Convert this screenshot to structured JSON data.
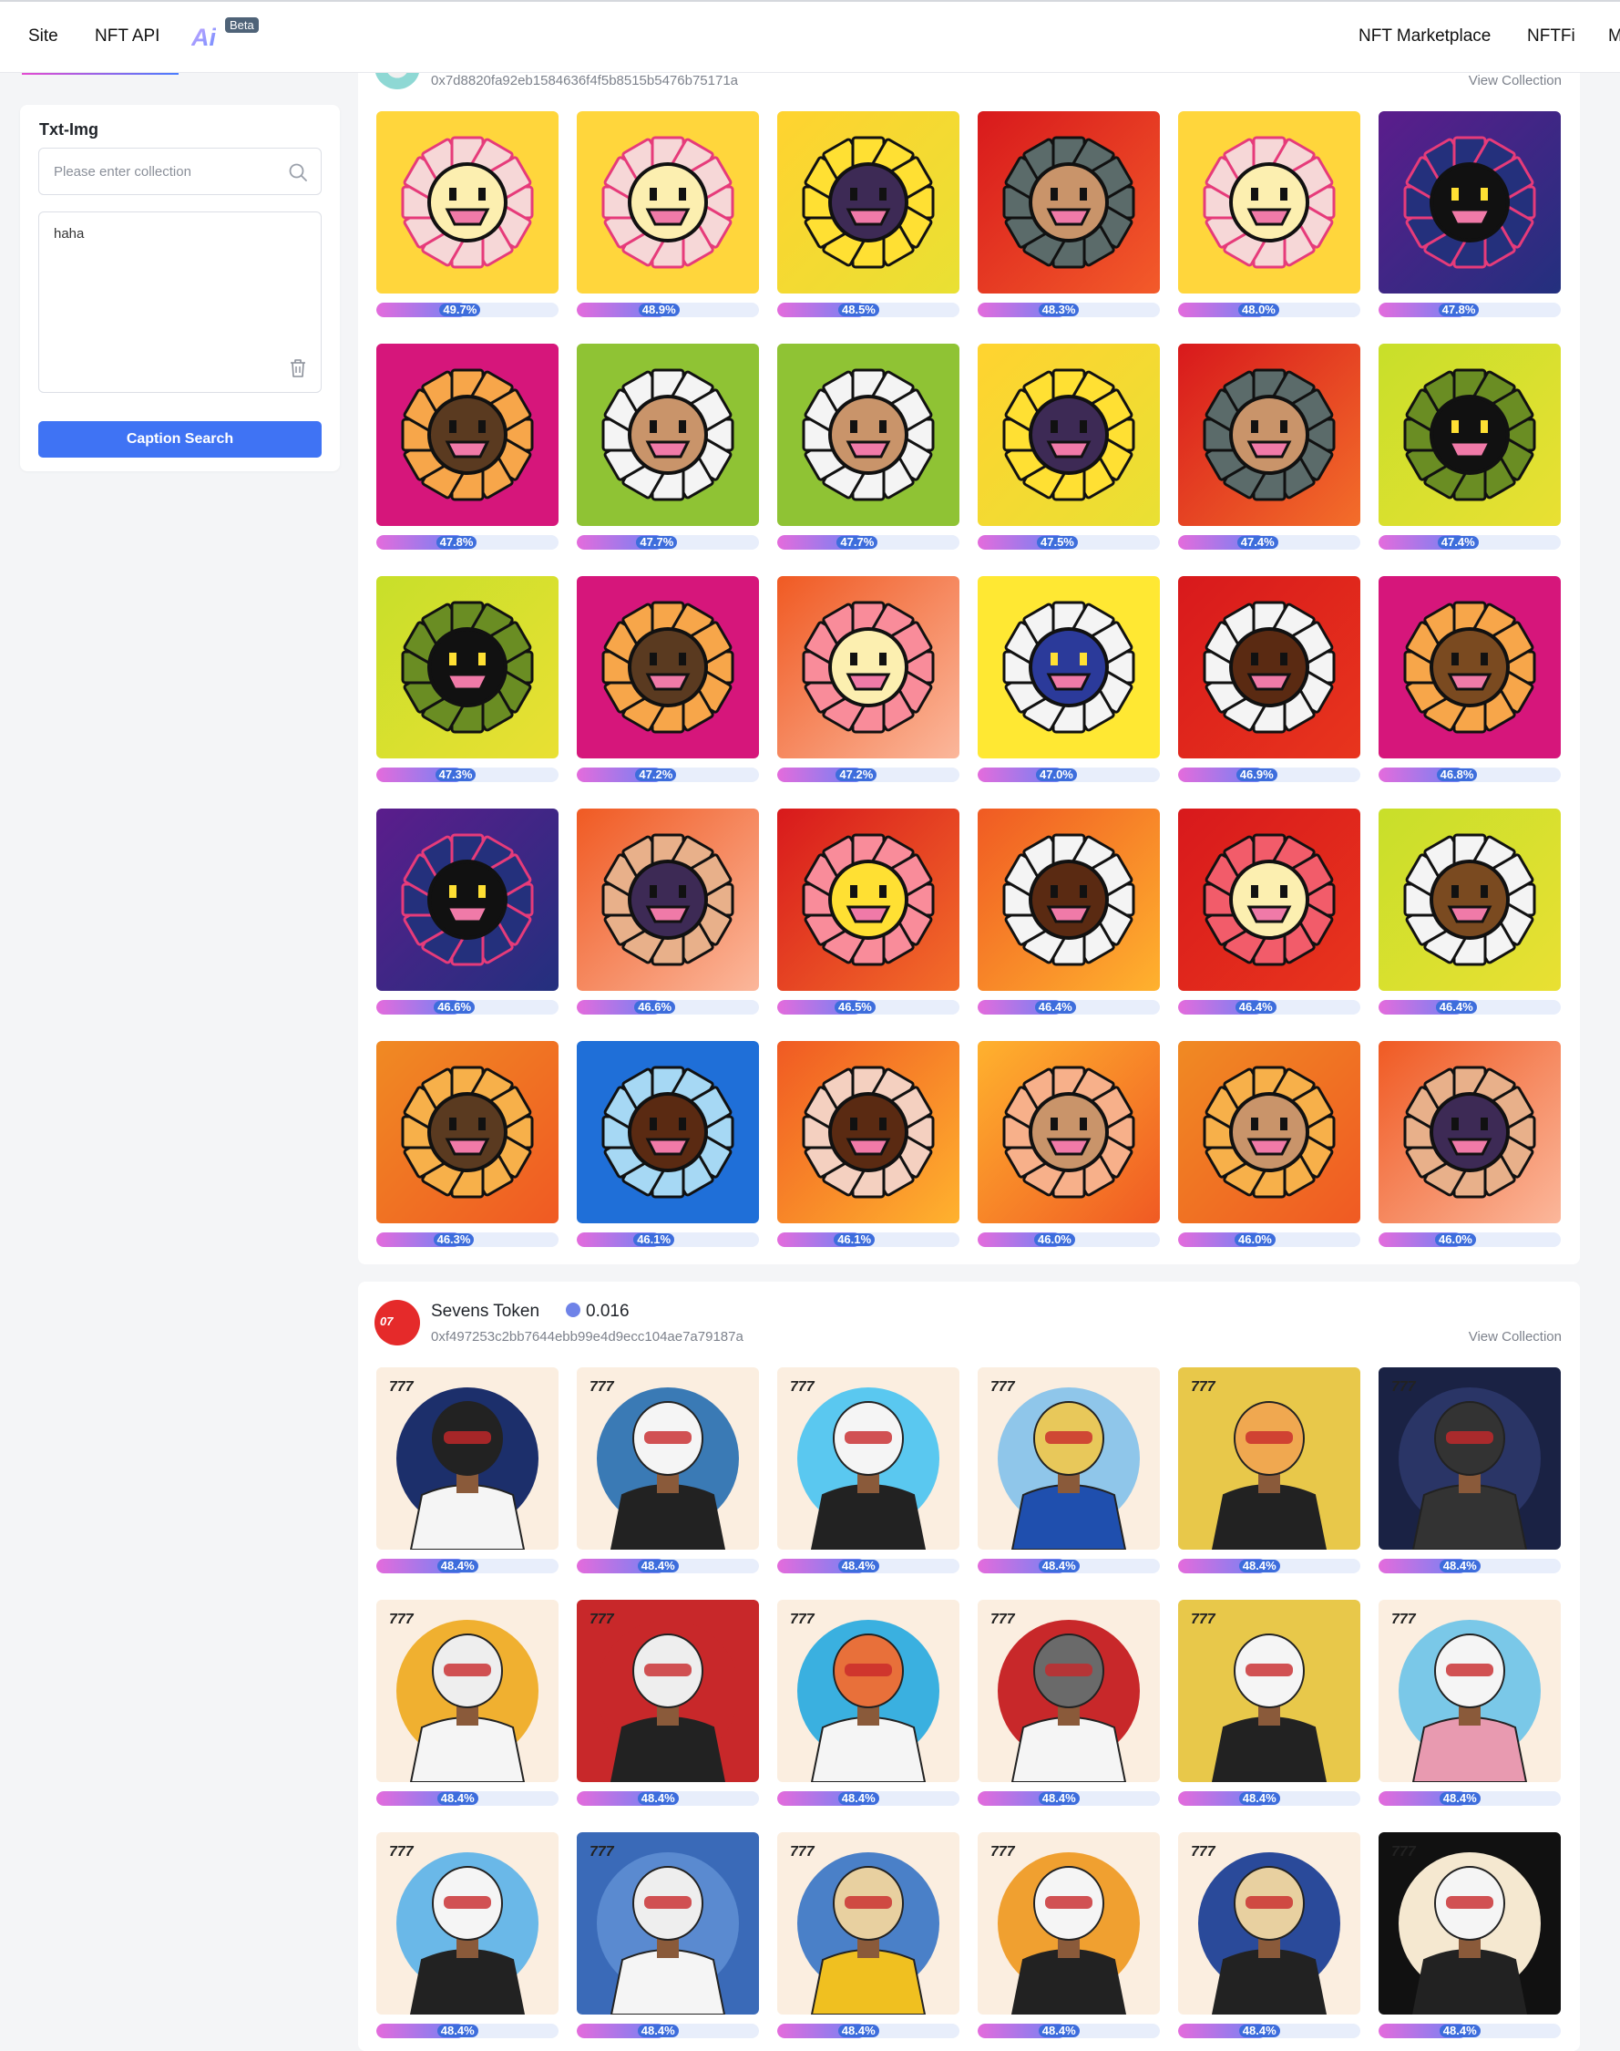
{
  "nav": {
    "items": [
      "Site",
      "NFT API"
    ],
    "ai_logo": "Ai",
    "beta_badge": "Beta",
    "right_items": [
      "NFT Marketplace",
      "NFTFi",
      "M"
    ]
  },
  "sidebar": {
    "title": "Txt-Img",
    "search_placeholder": "Please enter collection",
    "query_text": "haha",
    "button_label": "Caption Search"
  },
  "collections": [
    {
      "name": "",
      "price": "",
      "address": "0x7d8820fa92eb1584636f4f5b8515b5476b75171a",
      "view_label": "View Collection",
      "accent": "#f7c9d9",
      "items": [
        {
          "score": "49.7%",
          "bg": [
            "#ffd63c",
            "#ffd63c"
          ],
          "petal": "#f6d7d7",
          "outline": "#e63b7a",
          "face": "#fcefb0",
          "eyes": "#111"
        },
        {
          "score": "48.9%",
          "bg": [
            "#ffd63c",
            "#ffd63c"
          ],
          "petal": "#f6d7d7",
          "outline": "#e63b7a",
          "face": "#fcefb0",
          "eyes": "#111"
        },
        {
          "score": "48.5%",
          "bg": [
            "#ffd330",
            "#e9e033"
          ],
          "petal": "#ffe033",
          "outline": "#111",
          "face": "#3d2a55",
          "eyes": "#111"
        },
        {
          "score": "48.3%",
          "bg": [
            "#d8191c",
            "#f35b2a"
          ],
          "petal": "#5b6b6a",
          "outline": "#111",
          "face": "#c9946a",
          "eyes": "#111"
        },
        {
          "score": "48.0%",
          "bg": [
            "#ffd63c",
            "#ffd63c"
          ],
          "petal": "#f6d7d7",
          "outline": "#e63b7a",
          "face": "#fcefb0",
          "eyes": "#111"
        },
        {
          "score": "47.8%",
          "bg": [
            "#5b1d8c",
            "#23307e"
          ],
          "petal": "#24307c",
          "outline": "#e63b7a",
          "face": "#111",
          "eyes": "#ffe033"
        },
        {
          "score": "47.8%",
          "bg": [
            "#d6167b",
            "#d6167b"
          ],
          "petal": "#f7a64a",
          "outline": "#111",
          "face": "#5a3a20",
          "eyes": "#111"
        },
        {
          "score": "47.7%",
          "bg": [
            "#8fc334",
            "#8fc334"
          ],
          "petal": "#f4f4f4",
          "outline": "#111",
          "face": "#c9946a",
          "eyes": "#111"
        },
        {
          "score": "47.7%",
          "bg": [
            "#8fc334",
            "#8fc334"
          ],
          "petal": "#f4f4f4",
          "outline": "#111",
          "face": "#c9946a",
          "eyes": "#111"
        },
        {
          "score": "47.5%",
          "bg": [
            "#ffd330",
            "#e9e033"
          ],
          "petal": "#ffe033",
          "outline": "#111",
          "face": "#3d2a55",
          "eyes": "#111"
        },
        {
          "score": "47.4%",
          "bg": [
            "#d8191c",
            "#f36e2a"
          ],
          "petal": "#5b6b6a",
          "outline": "#111",
          "face": "#c9946a",
          "eyes": "#111"
        },
        {
          "score": "47.4%",
          "bg": [
            "#c8df2a",
            "#e9e033"
          ],
          "petal": "#6a8d23",
          "outline": "#111",
          "face": "#111",
          "eyes": "#ffe033"
        },
        {
          "score": "47.3%",
          "bg": [
            "#c8df2a",
            "#e9e033"
          ],
          "petal": "#6a8d23",
          "outline": "#111",
          "face": "#111",
          "eyes": "#ffe033"
        },
        {
          "score": "47.2%",
          "bg": [
            "#d6167b",
            "#d6167b"
          ],
          "petal": "#f7a64a",
          "outline": "#111",
          "face": "#5a3a20",
          "eyes": "#111"
        },
        {
          "score": "47.2%",
          "bg": [
            "#f05a23",
            "#fbb79b"
          ],
          "petal": "#f98c9a",
          "outline": "#111",
          "face": "#fcefb0",
          "eyes": "#111"
        },
        {
          "score": "47.0%",
          "bg": [
            "#ffe833",
            "#ffe833"
          ],
          "petal": "#f4f4f4",
          "outline": "#111",
          "face": "#2b3a9a",
          "eyes": "#ffe033"
        },
        {
          "score": "46.9%",
          "bg": [
            "#d8191c",
            "#e8351d"
          ],
          "petal": "#f4f4f4",
          "outline": "#111",
          "face": "#5a2a12",
          "eyes": "#111"
        },
        {
          "score": "46.8%",
          "bg": [
            "#d6167b",
            "#d6167b"
          ],
          "petal": "#f7a64a",
          "outline": "#111",
          "face": "#7a4a20",
          "eyes": "#111"
        },
        {
          "score": "46.6%",
          "bg": [
            "#5b1d8c",
            "#23307e"
          ],
          "petal": "#24307c",
          "outline": "#e63b7a",
          "face": "#111",
          "eyes": "#ffe033"
        },
        {
          "score": "46.6%",
          "bg": [
            "#f05a23",
            "#fbb79b"
          ],
          "petal": "#e8b08a",
          "outline": "#111",
          "face": "#3d2a55",
          "eyes": "#111"
        },
        {
          "score": "46.5%",
          "bg": [
            "#d8191c",
            "#f36e2a"
          ],
          "petal": "#f98c9a",
          "outline": "#111",
          "face": "#ffe033",
          "eyes": "#111"
        },
        {
          "score": "46.4%",
          "bg": [
            "#f05a23",
            "#ffb22e"
          ],
          "petal": "#f4f4f4",
          "outline": "#111",
          "face": "#5a2a12",
          "eyes": "#111"
        },
        {
          "score": "46.4%",
          "bg": [
            "#d8191c",
            "#e8351d"
          ],
          "petal": "#f25c6a",
          "outline": "#111",
          "face": "#fcefb0",
          "eyes": "#111"
        },
        {
          "score": "46.4%",
          "bg": [
            "#c8df2a",
            "#e9e033"
          ],
          "petal": "#f4f4f4",
          "outline": "#111",
          "face": "#7a4a20",
          "eyes": "#111"
        },
        {
          "score": "46.3%",
          "bg": [
            "#f08a23",
            "#f05a23"
          ],
          "petal": "#f7b04a",
          "outline": "#111",
          "face": "#5a3a20",
          "eyes": "#111"
        },
        {
          "score": "46.1%",
          "bg": [
            "#1f6fd8",
            "#1f6fd8"
          ],
          "petal": "#a6d8f4",
          "outline": "#111",
          "face": "#5a2a12",
          "eyes": "#111"
        },
        {
          "score": "46.1%",
          "bg": [
            "#f05a23",
            "#ffb22e"
          ],
          "petal": "#f4d0c0",
          "outline": "#111",
          "face": "#5a2a12",
          "eyes": "#111"
        },
        {
          "score": "46.0%",
          "bg": [
            "#ffb22e",
            "#f05a23"
          ],
          "petal": "#f7b08a",
          "outline": "#111",
          "face": "#c9946a",
          "eyes": "#111"
        },
        {
          "score": "46.0%",
          "bg": [
            "#f08a23",
            "#f05a23"
          ],
          "petal": "#f7b04a",
          "outline": "#111",
          "face": "#c9946a",
          "eyes": "#111"
        },
        {
          "score": "46.0%",
          "bg": [
            "#f05a23",
            "#fbb79b"
          ],
          "petal": "#e8b08a",
          "outline": "#111",
          "face": "#3d2a55",
          "eyes": "#111"
        }
      ]
    },
    {
      "name": "Sevens Token",
      "price": "0.016",
      "address": "0xf497253c2bb7644ebb99e4d9ecc104ae7a79187a",
      "view_label": "View Collection",
      "accent": "#e52a2a",
      "items": [
        {
          "score": "48.4%",
          "bg": "#fbeee0",
          "circle": "#1c2f6b",
          "head": "#222",
          "body": "#f5f5f5"
        },
        {
          "score": "48.4%",
          "bg": "#fbeee0",
          "circle": "#3a7ab5",
          "head": "#f5f5f5",
          "body": "#222"
        },
        {
          "score": "48.4%",
          "bg": "#fbeee0",
          "circle": "#5ac8f0",
          "head": "#f5f5f5",
          "body": "#222"
        },
        {
          "score": "48.4%",
          "bg": "#fbeee0",
          "circle": "#8fc6ea",
          "head": "#e8c85a",
          "body": "#1f4fae"
        },
        {
          "score": "48.4%",
          "bg": "#e8c84a",
          "circle": "#e8c84a",
          "head": "#f0a850",
          "body": "#222"
        },
        {
          "score": "48.4%",
          "bg": "#1a2244",
          "circle": "#2a3566",
          "head": "#333",
          "body": "#333"
        },
        {
          "score": "48.4%",
          "bg": "#fbeee0",
          "circle": "#f0b030",
          "head": "#eee",
          "body": "#f5f5f5"
        },
        {
          "score": "48.4%",
          "bg": "#c8282a",
          "circle": "#c8282a",
          "head": "#eee",
          "body": "#222"
        },
        {
          "score": "48.4%",
          "bg": "#fbeee0",
          "circle": "#3ab0e0",
          "head": "#e8703a",
          "body": "#f5f5f5"
        },
        {
          "score": "48.4%",
          "bg": "#fbeee0",
          "circle": "#c8282a",
          "head": "#6a6a6a",
          "body": "#f5f5f5"
        },
        {
          "score": "48.4%",
          "bg": "#e8c84a",
          "circle": "#e8c84a",
          "head": "#f5f5f5",
          "body": "#222"
        },
        {
          "score": "48.4%",
          "bg": "#fbeee0",
          "circle": "#7ac8e8",
          "head": "#f5f5f5",
          "body": "#e89ab0"
        },
        {
          "score": "48.4%",
          "bg": "#fbeee0",
          "circle": "#6ab8e8",
          "head": "#f5f5f5",
          "body": "#222"
        },
        {
          "score": "48.4%",
          "bg": "#3a6ab8",
          "circle": "#5a8ad0",
          "head": "#eee",
          "body": "#f5f5f5"
        },
        {
          "score": "48.4%",
          "bg": "#fbeee0",
          "circle": "#4a80c8",
          "head": "#e8d0a0",
          "body": "#f0c020"
        },
        {
          "score": "48.4%",
          "bg": "#fbeee0",
          "circle": "#f0a030",
          "head": "#f5f5f5",
          "body": "#222"
        },
        {
          "score": "48.4%",
          "bg": "#fbeee0",
          "circle": "#2a4a9a",
          "head": "#e8d0a0",
          "body": "#222"
        },
        {
          "score": "48.4%",
          "bg": "#111",
          "circle": "#f5e8d0",
          "head": "#f5f5f5",
          "body": "#222"
        }
      ]
    }
  ]
}
